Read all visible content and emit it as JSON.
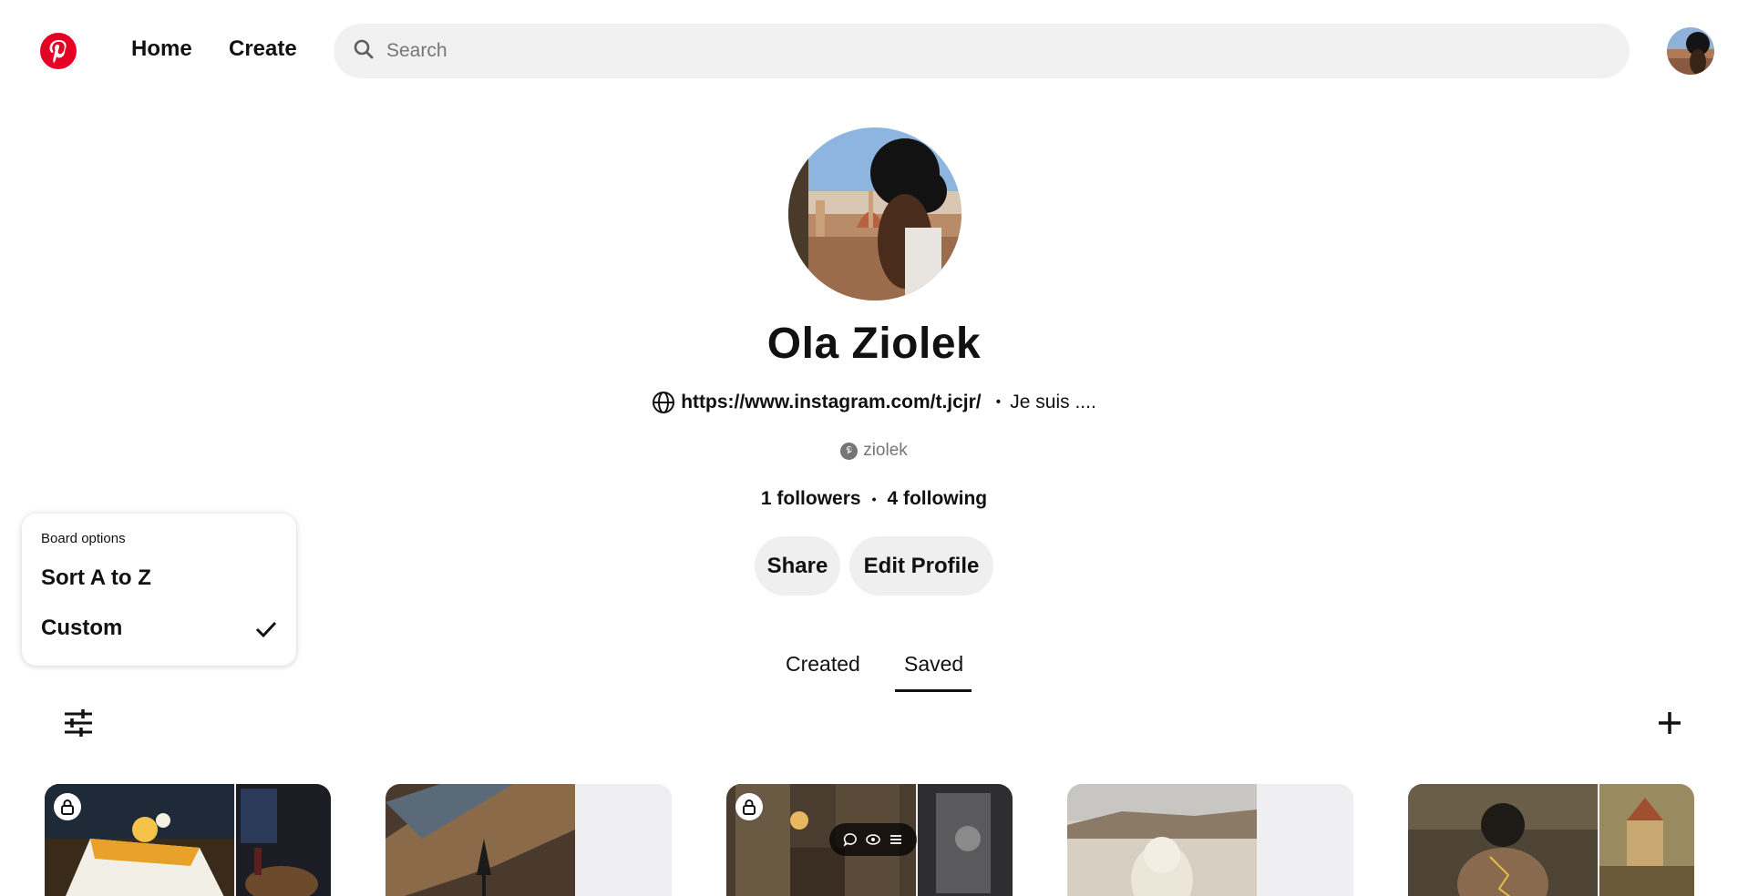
{
  "header": {
    "logo_name": "pinterest-logo",
    "nav": {
      "home": "Home",
      "create": "Create"
    },
    "search": {
      "placeholder": "Search",
      "value": ""
    },
    "brand_color": "#e60023"
  },
  "profile": {
    "name": "Ola Ziolek",
    "website": "https://www.instagram.com/t.jcjr/",
    "separator": "•",
    "bio": "Je suis ....",
    "username": "ziolek",
    "followers": "1 followers",
    "following": "4 following",
    "buttons": {
      "share": "Share",
      "edit": "Edit Profile"
    }
  },
  "tabs": [
    {
      "label": "Created",
      "active": false
    },
    {
      "label": "Saved",
      "active": true
    }
  ],
  "board_options": {
    "title": "Board options",
    "items": [
      {
        "label": "Sort A to Z",
        "selected": false
      },
      {
        "label": "Custom",
        "selected": true
      }
    ]
  },
  "boards": [
    {
      "locked": true,
      "colors": [
        "#d8a030",
        "#2a2a30"
      ]
    },
    {
      "locked": false,
      "colors": [
        "#7a5a3a",
        "#efeff2"
      ]
    },
    {
      "locked": true,
      "colors": [
        "#5a4a38",
        "#3a3a3a"
      ],
      "hover_actions": [
        "comment-icon",
        "eye-icon",
        "menu-icon"
      ]
    },
    {
      "locked": false,
      "colors": [
        "#cfc6b8",
        "#efeff2"
      ]
    },
    {
      "locked": false,
      "colors": [
        "#5a4a38",
        "#8a7a50"
      ]
    }
  ]
}
